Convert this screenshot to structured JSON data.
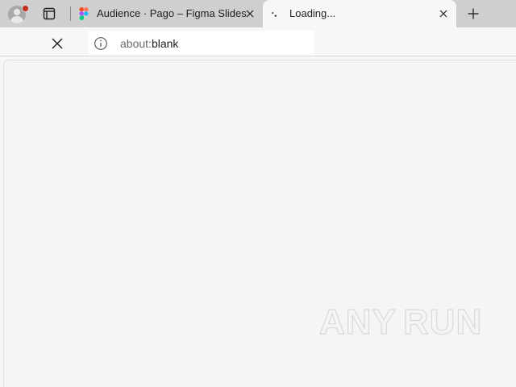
{
  "browser": {
    "tabs": [
      {
        "title": "Audience · Pago – Figma Slides",
        "favicon": "figma-icon",
        "active": false
      },
      {
        "title": "Loading...",
        "favicon": "loading-spinner-icon",
        "active": true
      }
    ],
    "toolbar": {
      "stop_icon": "close-icon",
      "info_icon": "info-icon",
      "url_scheme": "about:",
      "url_rest": "blank"
    },
    "new_tab_icon": "plus-icon",
    "profile_icon": "avatar-icon",
    "tab_actions_icon": "tab-actions-icon"
  },
  "watermark": {
    "left_text": "ANY",
    "right_text": "RUN",
    "logo_icon": "anyrun-play-logo"
  },
  "colors": {
    "tabstrip": "#cfcfcf",
    "active_tab": "#f7f7f7",
    "content": "#f5f5f5",
    "notification_dot": "#c42b1c"
  }
}
